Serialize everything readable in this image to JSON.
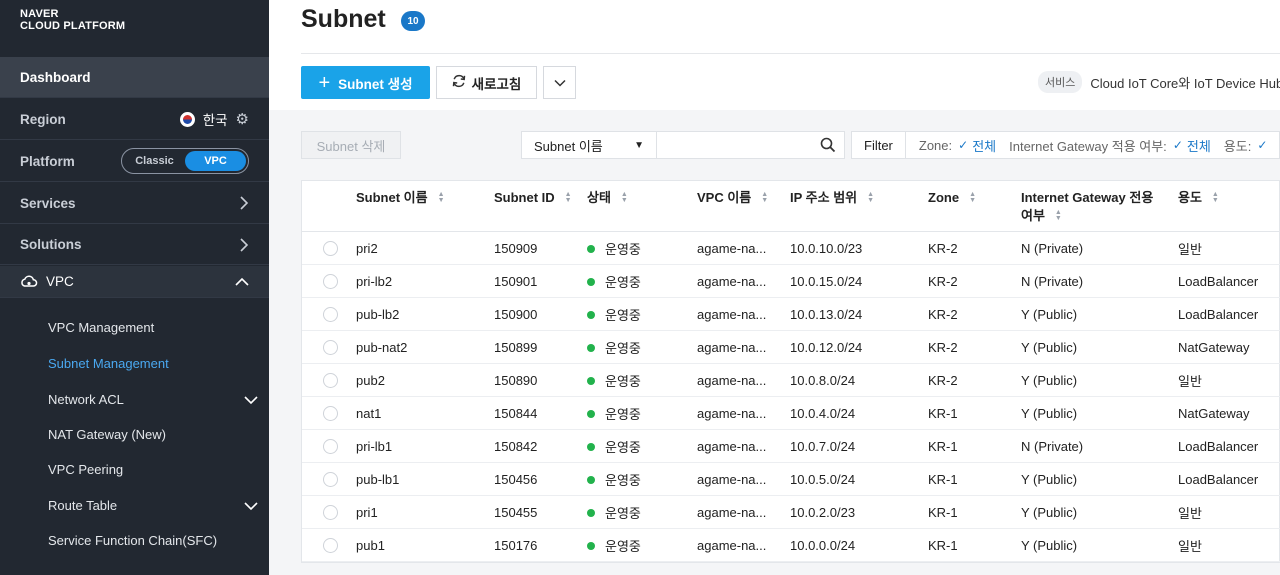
{
  "brand": {
    "line1": "NAVER",
    "line2": "CLOUD PLATFORM"
  },
  "sidebar": {
    "dashboard": "Dashboard",
    "region_label": "Region",
    "region_value": "한국",
    "platform_label": "Platform",
    "platform_options": [
      "Classic",
      "VPC"
    ],
    "platform_selected": "VPC",
    "services": "Services",
    "solutions": "Solutions",
    "vpc": "VPC",
    "vpc_items": [
      {
        "label": "VPC Management",
        "active": false,
        "expandable": false
      },
      {
        "label": "Subnet Management",
        "active": true,
        "expandable": false
      },
      {
        "label": "Network ACL",
        "active": false,
        "expandable": true
      },
      {
        "label": "NAT Gateway (New)",
        "active": false,
        "expandable": false
      },
      {
        "label": "VPC Peering",
        "active": false,
        "expandable": false
      },
      {
        "label": "Route Table",
        "active": false,
        "expandable": true
      },
      {
        "label": "Service Function Chain(SFC)",
        "active": false,
        "expandable": false
      }
    ]
  },
  "page": {
    "title": "Subnet",
    "count": "10"
  },
  "toolbar": {
    "create_label": "Subnet 생성",
    "refresh_label": "새로고침",
    "notice_tag": "서비스",
    "notice_text": "Cloud IoT Core와 IoT Device Hub 서"
  },
  "filterbar": {
    "delete_label": "Subnet 삭제",
    "search_field": "Subnet 이름",
    "search_value": "",
    "filter_label": "Filter",
    "zone_label": "Zone:",
    "zone_value": "전체",
    "igw_label": "Internet Gateway 적용 여부:",
    "igw_value": "전체",
    "usage_label": "용도:"
  },
  "table": {
    "columns": [
      "Subnet 이름",
      "Subnet ID",
      "상태",
      "VPC 이름",
      "IP 주소 범위",
      "Zone",
      "Internet Gateway 전용",
      "여부",
      "용도"
    ],
    "rows": [
      {
        "name": "pri2",
        "id": "150909",
        "status": "운영중",
        "vpc": "agame-na...",
        "ip": "10.0.10.0/23",
        "zone": "KR-2",
        "igw": "N (Private)",
        "usage": "일반"
      },
      {
        "name": "pri-lb2",
        "id": "150901",
        "status": "운영중",
        "vpc": "agame-na...",
        "ip": "10.0.15.0/24",
        "zone": "KR-2",
        "igw": "N (Private)",
        "usage": "LoadBalancer"
      },
      {
        "name": "pub-lb2",
        "id": "150900",
        "status": "운영중",
        "vpc": "agame-na...",
        "ip": "10.0.13.0/24",
        "zone": "KR-2",
        "igw": "Y (Public)",
        "usage": "LoadBalancer"
      },
      {
        "name": "pub-nat2",
        "id": "150899",
        "status": "운영중",
        "vpc": "agame-na...",
        "ip": "10.0.12.0/24",
        "zone": "KR-2",
        "igw": "Y (Public)",
        "usage": "NatGateway"
      },
      {
        "name": "pub2",
        "id": "150890",
        "status": "운영중",
        "vpc": "agame-na...",
        "ip": "10.0.8.0/24",
        "zone": "KR-2",
        "igw": "Y (Public)",
        "usage": "일반"
      },
      {
        "name": "nat1",
        "id": "150844",
        "status": "운영중",
        "vpc": "agame-na...",
        "ip": "10.0.4.0/24",
        "zone": "KR-1",
        "igw": "Y (Public)",
        "usage": "NatGateway"
      },
      {
        "name": "pri-lb1",
        "id": "150842",
        "status": "운영중",
        "vpc": "agame-na...",
        "ip": "10.0.7.0/24",
        "zone": "KR-1",
        "igw": "N (Private)",
        "usage": "LoadBalancer"
      },
      {
        "name": "pub-lb1",
        "id": "150456",
        "status": "운영중",
        "vpc": "agame-na...",
        "ip": "10.0.5.0/24",
        "zone": "KR-1",
        "igw": "Y (Public)",
        "usage": "LoadBalancer"
      },
      {
        "name": "pri1",
        "id": "150455",
        "status": "운영중",
        "vpc": "agame-na...",
        "ip": "10.0.2.0/23",
        "zone": "KR-1",
        "igw": "Y (Public)",
        "usage": "일반"
      },
      {
        "name": "pub1",
        "id": "150176",
        "status": "운영중",
        "vpc": "agame-na...",
        "ip": "10.0.0.0/24",
        "zone": "KR-1",
        "igw": "Y (Public)",
        "usage": "일반"
      }
    ]
  },
  "colors": {
    "accent": "#1aa3e8",
    "sidebar_bg": "#222831",
    "status_ok": "#22b24c",
    "link_active": "#4aa8f0"
  }
}
